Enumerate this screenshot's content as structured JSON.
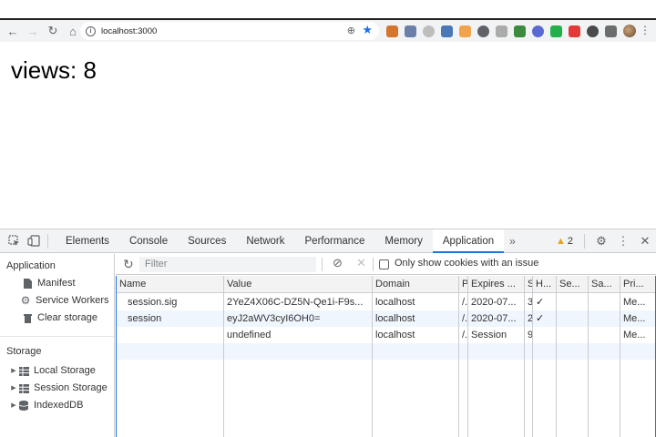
{
  "browser": {
    "url": "localhost:3000",
    "nav": {
      "back": "←",
      "forward": "→",
      "reload": "↻",
      "home": "⌂"
    },
    "extensions": [
      "#d5742b",
      "#6b7fa8",
      "#bdbdbd",
      "#4a77b5",
      "#f2a34a",
      "#5f6368",
      "#ababab",
      "#3b8a3e",
      "#5b6ad0",
      "#23b04a",
      "#e53935",
      "#4a4a4a",
      "#6d6d6d"
    ],
    "menu_icon": "⋮"
  },
  "page": {
    "views_text": "views: 8"
  },
  "devtools": {
    "tabs": [
      {
        "label": "Elements",
        "active": false
      },
      {
        "label": "Console",
        "active": false
      },
      {
        "label": "Sources",
        "active": false
      },
      {
        "label": "Network",
        "active": false
      },
      {
        "label": "Performance",
        "active": false
      },
      {
        "label": "Memory",
        "active": false
      },
      {
        "label": "Application",
        "active": true
      }
    ],
    "more": "»",
    "warnings": "2",
    "close": "✕",
    "sidebar": {
      "app_head": "Application",
      "app_items": [
        "Manifest",
        "Service Workers",
        "Clear storage"
      ],
      "storage_head": "Storage",
      "storage_items": [
        "Local Storage",
        "Session Storage",
        "IndexedDB"
      ]
    },
    "filter": {
      "placeholder": "Filter",
      "only_issue": "Only show cookies with an issue"
    },
    "cookies": {
      "columns": [
        "Name",
        "Value",
        "Domain",
        "P",
        "Expires ...",
        "S",
        "H...",
        "Se...",
        "Sa...",
        "Pri..."
      ],
      "rows": [
        [
          "session.sig",
          "2YeZ4X06C-DZ5N-Qe1i-F9s...",
          "localhost",
          "/.",
          "2020-07...",
          "3",
          "✓",
          "",
          "",
          "Me..."
        ],
        [
          "session",
          "eyJ2aWV3cyI6OH0=",
          "localhost",
          "/.",
          "2020-07...",
          "2",
          "✓",
          "",
          "",
          "Me..."
        ],
        [
          "",
          "undefined",
          "localhost",
          "/.",
          "Session",
          "9",
          "",
          "",
          "",
          "Me..."
        ]
      ]
    }
  }
}
